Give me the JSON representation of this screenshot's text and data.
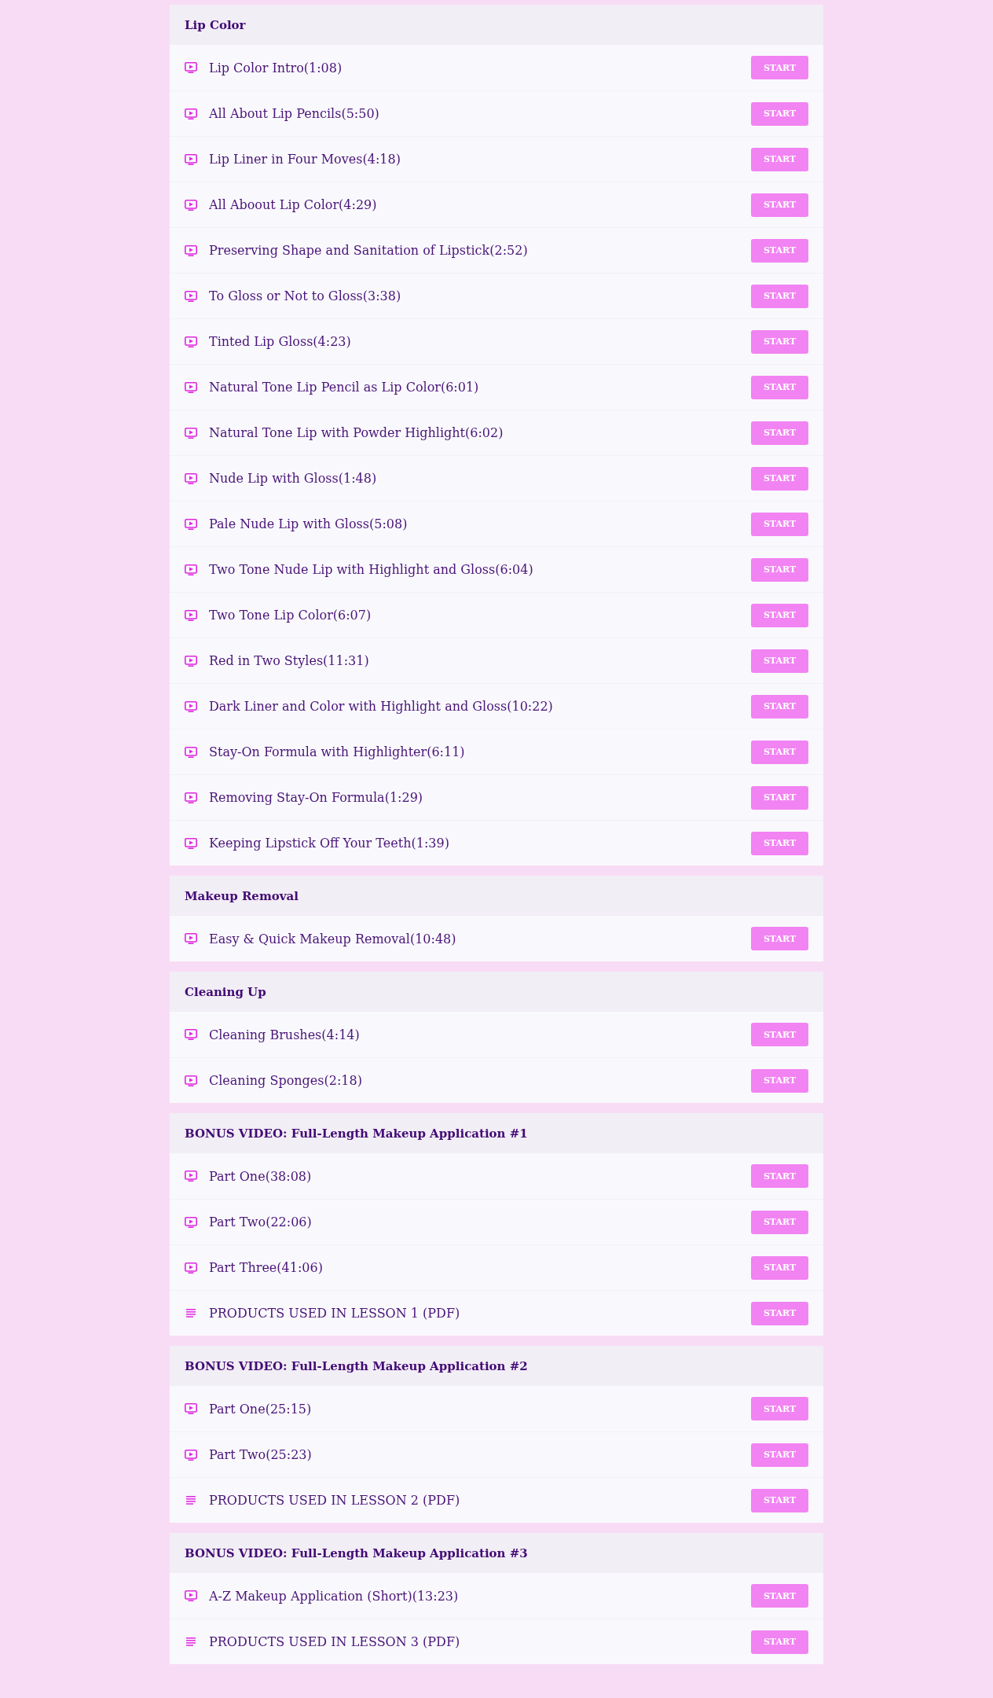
{
  "sections": [
    {
      "title": "Lip Color",
      "lessons": [
        {
          "kind": "video",
          "title": "Lip Color Intro(1:08)",
          "button": "START"
        },
        {
          "kind": "video",
          "title": "All About Lip Pencils(5:50)",
          "button": "START"
        },
        {
          "kind": "video",
          "title": "Lip Liner in Four Moves(4:18)",
          "button": "START"
        },
        {
          "kind": "video",
          "title": "All Aboout Lip Color(4:29)",
          "button": "START"
        },
        {
          "kind": "video",
          "title": "Preserving Shape and Sanitation of Lipstick(2:52)",
          "button": "START"
        },
        {
          "kind": "video",
          "title": "To Gloss or Not to Gloss(3:38)",
          "button": "START"
        },
        {
          "kind": "video",
          "title": "Tinted Lip Gloss(4:23)",
          "button": "START"
        },
        {
          "kind": "video",
          "title": "Natural Tone Lip Pencil as Lip Color(6:01)",
          "button": "START"
        },
        {
          "kind": "video",
          "title": "Natural Tone Lip with Powder Highlight(6:02)",
          "button": "START"
        },
        {
          "kind": "video",
          "title": "Nude Lip with Gloss(1:48)",
          "button": "START"
        },
        {
          "kind": "video",
          "title": "Pale Nude Lip with Gloss(5:08)",
          "button": "START"
        },
        {
          "kind": "video",
          "title": "Two Tone Nude Lip with Highlight and Gloss(6:04)",
          "button": "START"
        },
        {
          "kind": "video",
          "title": "Two Tone Lip Color(6:07)",
          "button": "START"
        },
        {
          "kind": "video",
          "title": "Red in Two Styles(11:31)",
          "button": "START"
        },
        {
          "kind": "video",
          "title": "Dark Liner and Color with Highlight and Gloss(10:22)",
          "button": "START"
        },
        {
          "kind": "video",
          "title": "Stay-On Formula with Highlighter(6:11)",
          "button": "START"
        },
        {
          "kind": "video",
          "title": "Removing Stay-On Formula(1:29)",
          "button": "START"
        },
        {
          "kind": "video",
          "title": "Keeping Lipstick Off Your Teeth(1:39)",
          "button": "START"
        }
      ]
    },
    {
      "title": "Makeup Removal",
      "lessons": [
        {
          "kind": "video",
          "title": "Easy & Quick Makeup Removal(10:48)",
          "button": "START"
        }
      ]
    },
    {
      "title": "Cleaning Up",
      "lessons": [
        {
          "kind": "video",
          "title": "Cleaning Brushes(4:14)",
          "button": "START"
        },
        {
          "kind": "video",
          "title": "Cleaning Sponges(2:18)",
          "button": "START"
        }
      ]
    },
    {
      "title": "BONUS VIDEO: Full-Length Makeup Application #1",
      "lessons": [
        {
          "kind": "video",
          "title": "Part One(38:08)",
          "button": "START"
        },
        {
          "kind": "video",
          "title": "Part Two(22:06)",
          "button": "START"
        },
        {
          "kind": "video",
          "title": "Part Three(41:06)",
          "button": "START"
        },
        {
          "kind": "document",
          "title": "PRODUCTS USED IN LESSON 1 (PDF)",
          "button": "START"
        }
      ]
    },
    {
      "title": "BONUS VIDEO: Full-Length Makeup Application #2",
      "lessons": [
        {
          "kind": "video",
          "title": "Part One(25:15)",
          "button": "START"
        },
        {
          "kind": "video",
          "title": "Part Two(25:23)",
          "button": "START"
        },
        {
          "kind": "document",
          "title": "PRODUCTS USED IN LESSON 2 (PDF)",
          "button": "START"
        }
      ]
    },
    {
      "title": "BONUS VIDEO: Full-Length Makeup Application #3",
      "lessons": [
        {
          "kind": "video",
          "title": "A-Z Makeup Application (Short)(13:23)",
          "button": "START"
        },
        {
          "kind": "document",
          "title": "PRODUCTS USED IN LESSON 3 (PDF)",
          "button": "START"
        }
      ]
    }
  ]
}
